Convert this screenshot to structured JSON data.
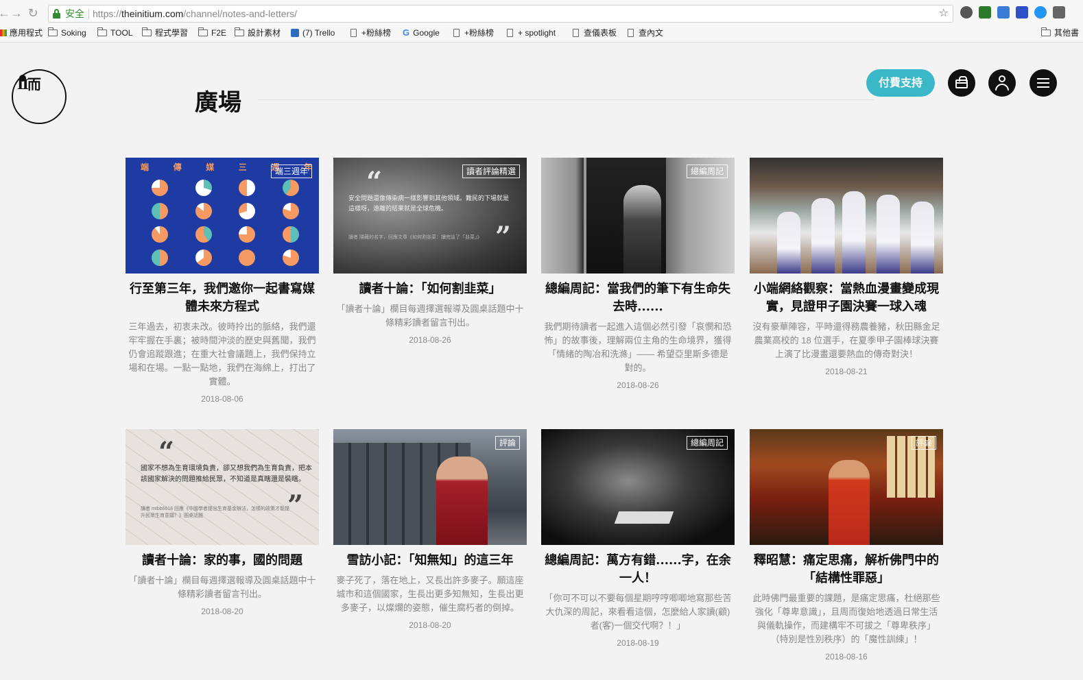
{
  "browser": {
    "secure_label": "安全",
    "url_scheme": "https://",
    "url_host": "theinitium.com",
    "url_path": "/channel/notes-and-letters/",
    "bookmarks": [
      "應用程式",
      "Soking",
      "TOOL",
      "程式學習",
      "F2E",
      "設計素材",
      "(7) Trello",
      "+粉絲榜",
      "Google",
      "+粉絲榜",
      "+ spotlight",
      "查儀表板",
      "查內文",
      "其他書"
    ]
  },
  "site": {
    "page_title": "廣場",
    "support_label": "付費支持",
    "logo_glyph": "Ⅱ而"
  },
  "cards": [
    {
      "badge": "端三週年",
      "title": "行至第三年，我們邀你一起書寫媒體未來方程式",
      "summary": "三年過去，初衷未改。彼時拎出的脈絡，我們還牢牢握在手裏；被時間沖淡的歷史與舊聞，我們仍會追蹤跟進；在重大社會議題上，我們保持立場和在場。一點一點地，我們在海綿上，打出了實體。",
      "date": "2018-08-06",
      "art_letters": [
        "端",
        "傳",
        "媒",
        "三",
        "週",
        "年"
      ]
    },
    {
      "badge": "讀者評論精選",
      "title": "讀者十論：「如何割韭菜」",
      "summary": "「讀者十論」欄目每週擇選報導及圓桌話題中十條精彩讀者留言刊出。",
      "date": "2018-08-26",
      "quote_text": "安全問題還像傳染病一樣影響到其他領域。難民的下場就是這樣呀，遠離的結果就是全球危機。",
      "quote_source": "讀者 隱藏的名字，回應文章《如何割韭菜：讀完這了「韭菜」》"
    },
    {
      "badge": "總編周記",
      "title": "總編周記：當我們的筆下有生命失去時......",
      "summary": "我們期待讀者一起進入這個必然引發「哀憫和恐怖」的故事後，理解兩位主角的生命境界，獲得「情緒的陶冶和洗滌」—— 希望亞里斯多德是對的。",
      "date": "2018-08-26"
    },
    {
      "badge": "",
      "title": "小端網絡觀察：當熱血漫畫變成現實，見證甲子園決賽一球入魂",
      "summary": "沒有豪華陣容，平時還得務農養豬，秋田縣金足農業高校的 18 位選手，在夏季甲子園棒球決賽上演了比漫畫還要熱血的傳奇對決！",
      "date": "2018-08-21"
    },
    {
      "badge": "",
      "title": "讀者十論：家的事，國的問題",
      "summary": "「讀者十論」欄目每週擇選報導及圓桌話題中十條精彩讀者留言刊出。",
      "date": "2018-08-20",
      "quote_text": "國家不想為生育環境負責，卻又想我們為生育負責，把本該國家解決的問題推給民眾，不知道是真瞎還是裝瞎。",
      "quote_source": "讀者 mtbb6618 回應《中國學者提出生育基金辦法，怎樣的政策才能提升民眾生育意願？》圓桌話題"
    },
    {
      "badge": "評論",
      "title": "雪訪小記：「知無知」的這三年",
      "summary": "麥子死了，落在地上，又長出許多麥子。願這座城市和這個國家，生長出更多知無知，生長出更多麥子，以燦爛的姿態，催生腐朽者的倒掉。",
      "date": "2018-08-20"
    },
    {
      "badge": "總編周記",
      "title": "總編周記：萬方有錯......字，在余一人！",
      "summary": "「你可不可以不要每個星期哼哼唧唧地寫那些苦大仇深的周記，來看看這個，怎麼給人家讀(顧)者(客)一個交代啊？！」",
      "date": "2018-08-19"
    },
    {
      "badge": "評論",
      "title": "釋昭慧：痛定思痛，解析佛門中的「結構性罪惡」",
      "summary": "此時佛門最重要的課題，是痛定思痛，杜絕那些強化「尊卑意識」，且周而復始地透過日常生活與儀軌操作，而建構牢不可拔之「尊卑秩序」（特別是性別秩序）的「魔性訓練」！",
      "date": "2018-08-16"
    }
  ],
  "colors": {
    "accent": "#3bb8c8",
    "secure": "#2e8b2e",
    "pie_orange": "#f59a62",
    "pie_teal": "#5ebfb6"
  }
}
